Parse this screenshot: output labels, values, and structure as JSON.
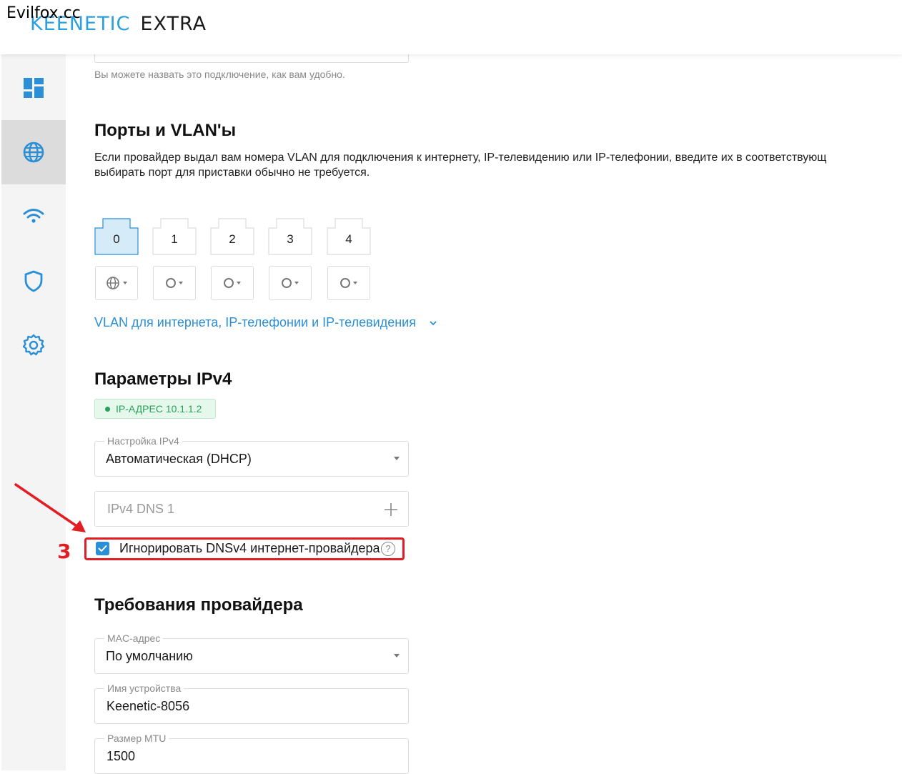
{
  "watermark": "Evilfox.cc",
  "logo": {
    "brand": "KEENETIC",
    "model": "EXTRA"
  },
  "sidebar": {
    "items": [
      {
        "id": "dashboard",
        "icon": "dashboard-icon",
        "active": false
      },
      {
        "id": "internet",
        "icon": "globe-icon",
        "active": true
      },
      {
        "id": "wifi",
        "icon": "wifi-icon",
        "active": false
      },
      {
        "id": "security",
        "icon": "shield-icon",
        "active": false
      },
      {
        "id": "settings",
        "icon": "gear-icon",
        "active": false
      }
    ]
  },
  "connection_name_hint": "Вы можете назвать это подключение, как вам удобно.",
  "ports_section": {
    "title": "Порты и VLAN'ы",
    "description_line1": "Если провайдер выдал вам номера VLAN для подключения к интернету, IP-телевидению или IP-телефонии, введите их в соответствующ",
    "description_line2": "выбирать порт для приставки обычно не требуется.",
    "ports": [
      "0",
      "1",
      "2",
      "3",
      "4"
    ],
    "vlan_link": "VLAN для интернета, IP-телефонии и IP-телевидения"
  },
  "ipv4_section": {
    "title": "Параметры IPv4",
    "ip_badge": "IP-АДРЕС 10.1.1.2",
    "ipv4_setting_label": "Настройка IPv4",
    "ipv4_setting_value": "Автоматическая (DHCP)",
    "dns_placeholder": "IPv4 DNS 1",
    "ignore_dns_label": "Игнорировать DNSv4 интернет-провайдера",
    "ignore_dns_checked": true,
    "help_symbol": "?",
    "annotation_number": "3"
  },
  "provider_section": {
    "title": "Требования провайдера",
    "mac_label": "MAC-адрес",
    "mac_value": "По умолчанию",
    "device_name_label": "Имя устройства",
    "device_name_value": "Keenetic-8056",
    "mtu_label": "Размер MTU",
    "mtu_value": "1500"
  },
  "colors": {
    "accent": "#2a8fd6",
    "brand": "#2aa0de",
    "annotation_red": "#e21d24",
    "badge_green": "#26a05a",
    "active_port": "#d6ebf8"
  }
}
